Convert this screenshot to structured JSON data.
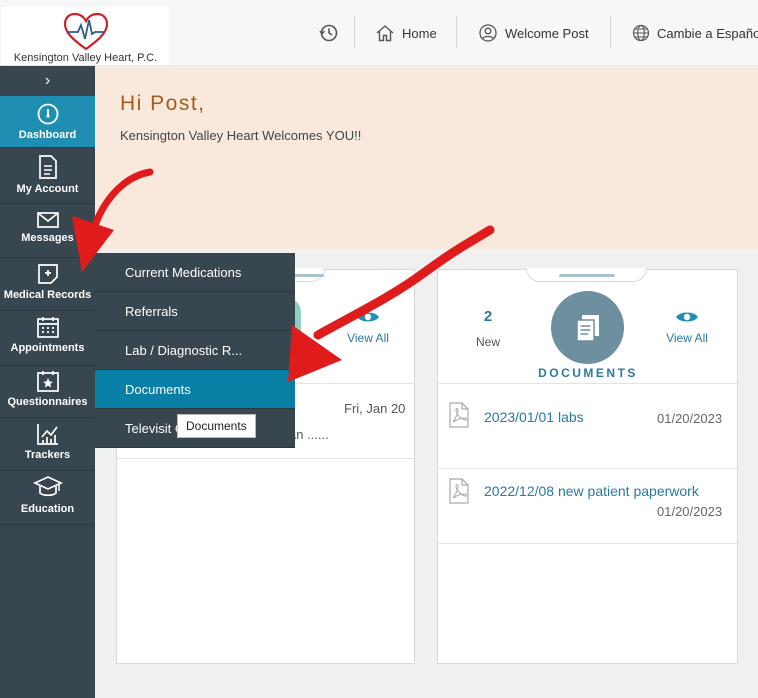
{
  "header": {
    "logo_text": "Kensington Valley Heart, P.C.",
    "home_label": "Home",
    "welcome_label": "Welcome Post",
    "language_label": "Cambie a Español"
  },
  "sidebar": {
    "items": [
      {
        "label": "Dashboard",
        "icon": "dashboard-icon",
        "active": true
      },
      {
        "label": "My Account",
        "icon": "account-icon"
      },
      {
        "label": "Messages",
        "icon": "envelope-icon"
      },
      {
        "label": "Medical Records",
        "icon": "medical-records-icon"
      },
      {
        "label": "Appointments",
        "icon": "calendar-icon"
      },
      {
        "label": "Questionnaires",
        "icon": "questionnaire-icon"
      },
      {
        "label": "Trackers",
        "icon": "chart-icon"
      },
      {
        "label": "Education",
        "icon": "graduation-cap-icon"
      }
    ]
  },
  "submenu": {
    "items": [
      "Current Medications",
      "Referrals",
      "Lab / Diagnostic R...",
      "Documents",
      "Televisit C"
    ],
    "selected": "Documents",
    "tooltip": "Documents"
  },
  "welcome": {
    "greeting": "Hi Post,",
    "message": "Kensington Valley Heart Welcomes YOU!!"
  },
  "left_card": {
    "view_all_label": "View All",
    "item_date": "Fri, Jan 20",
    "item_snippet": "an ......"
  },
  "documents_card": {
    "new_count": "2",
    "new_label": "New",
    "title": "DOCUMENTS",
    "view_all_label": "View All",
    "items": [
      {
        "name": "2023/01/01 labs",
        "date": "01/20/2023"
      },
      {
        "name": "2022/12/08 new patient paperwork",
        "date": "01/20/2023"
      }
    ]
  },
  "colors": {
    "sidebar": "#37464f",
    "active": "#1e8fb3",
    "submenu_selected": "#087fa5",
    "accent": "#2879a5",
    "welcome_bg": "#f9e9dc",
    "greeting": "#a65b1b",
    "annotation_arrow": "#e01b1b"
  }
}
